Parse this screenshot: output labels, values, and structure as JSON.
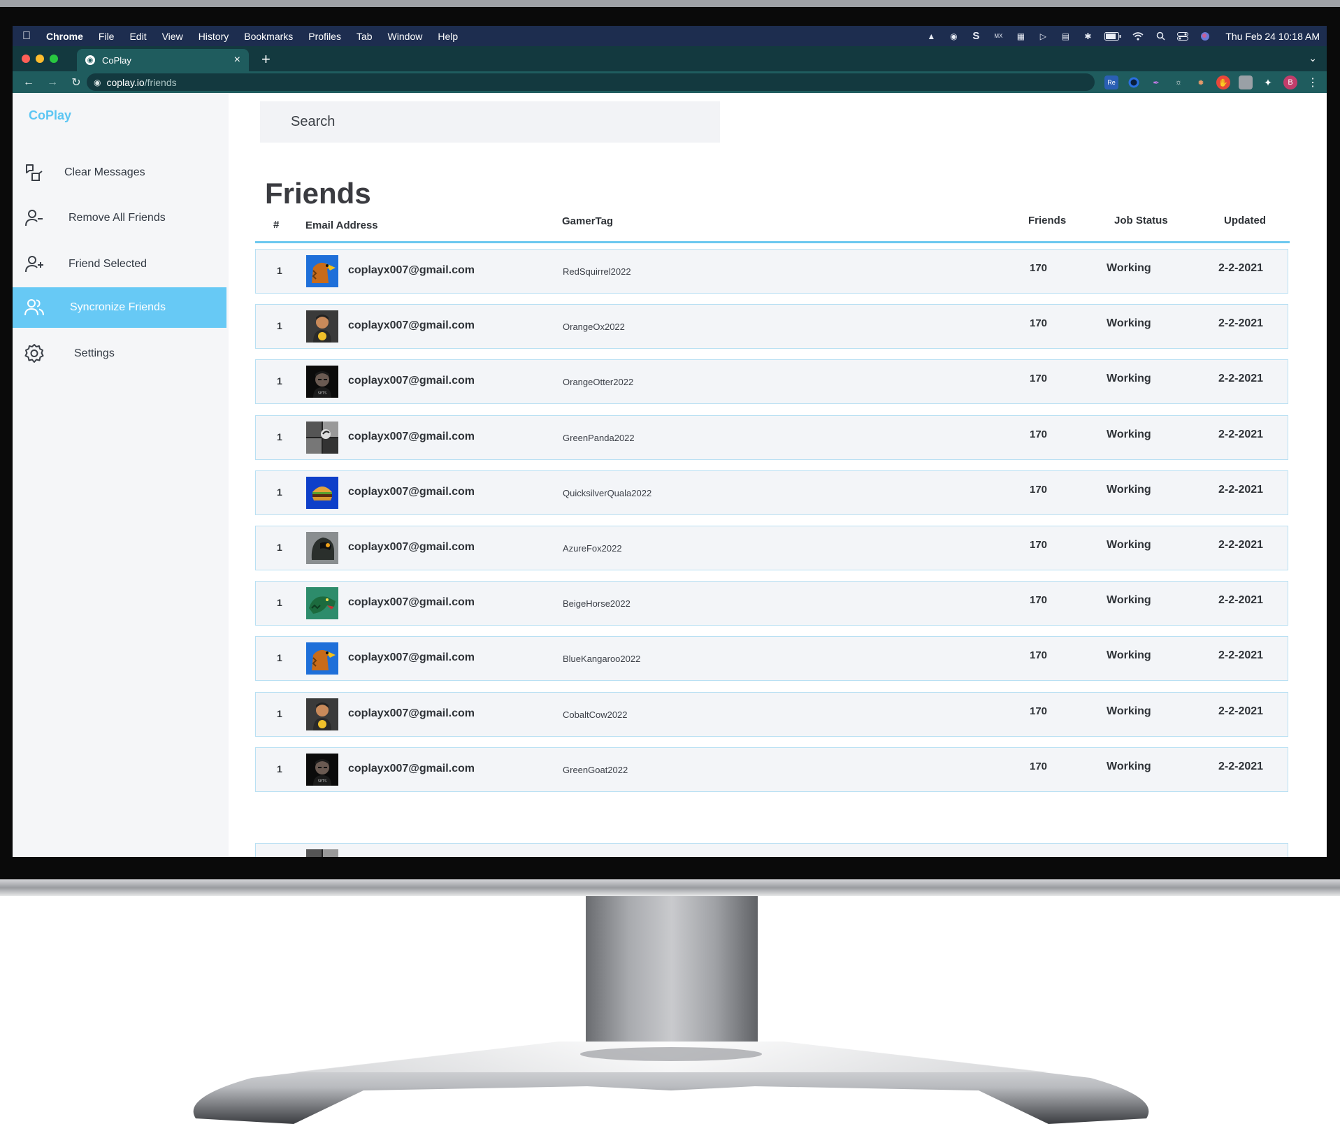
{
  "mac_menubar": {
    "app_name": "Chrome",
    "menus": [
      "File",
      "Edit",
      "View",
      "History",
      "Bookmarks",
      "Profiles",
      "Tab",
      "Window",
      "Help"
    ],
    "clock": "Thu Feb 24  10:18 AM",
    "status_icons": [
      "drive-icon",
      "globe-icon",
      "s-icon",
      "mx-icon",
      "grid-icon",
      "play-icon",
      "card-icon",
      "bluetooth-icon",
      "battery-icon",
      "wifi-icon",
      "spotlight-icon",
      "control-center-icon",
      "siri-icon"
    ]
  },
  "browser": {
    "tab_title": "CoPlay",
    "new_tab_label": "+",
    "url_host": "coplay.io",
    "url_path": "/friends",
    "profile_initial": "B",
    "colors": {
      "menubar": "#1d2d4f",
      "tabbar": "#13393f",
      "toolbar": "#1f5c5e"
    }
  },
  "app": {
    "brand": "CoPlay",
    "sidebar": [
      {
        "label": "Clear Messages",
        "icon": "clear-messages-icon",
        "active": false
      },
      {
        "label": "Remove All Friends",
        "icon": "user-minus-icon",
        "active": false
      },
      {
        "label": "Friend Selected",
        "icon": "user-plus-icon",
        "active": false
      },
      {
        "label": "Syncronize Friends",
        "icon": "users-icon",
        "active": true
      },
      {
        "label": "Settings",
        "icon": "gear-icon",
        "active": false
      }
    ],
    "search_placeholder": "Search",
    "page_title": "Friends",
    "accent_color": "#67c9f5",
    "table": {
      "headers": {
        "num": "#",
        "email": "Email Address",
        "gamertag": "GamerTag",
        "friends": "Friends",
        "status": "Job Status",
        "updated": "Updated"
      },
      "rows": [
        {
          "num": "1",
          "avatar": "eagle-avatar",
          "email": "coplayx007@gmail.com",
          "gamertag": "RedSquirrel2022",
          "friends": "170",
          "status": "Working",
          "updated": "2-2-2021"
        },
        {
          "num": "1",
          "avatar": "gamer-avatar",
          "email": "coplayx007@gmail.com",
          "gamertag": "OrangeOx2022",
          "friends": "170",
          "status": "Working",
          "updated": "2-2-2021"
        },
        {
          "num": "1",
          "avatar": "dark-face-avatar",
          "email": "coplayx007@gmail.com",
          "gamertag": "OrangeOtter2022",
          "friends": "170",
          "status": "Working",
          "updated": "2-2-2021"
        },
        {
          "num": "1",
          "avatar": "collage-avatar",
          "email": "coplayx007@gmail.com",
          "gamertag": "GreenPanda2022",
          "friends": "170",
          "status": "Working",
          "updated": "2-2-2021"
        },
        {
          "num": "1",
          "avatar": "burger-avatar",
          "email": "coplayx007@gmail.com",
          "gamertag": "QuicksilverQuala2022",
          "friends": "170",
          "status": "Working",
          "updated": "2-2-2021"
        },
        {
          "num": "1",
          "avatar": "helmet-avatar",
          "email": "coplayx007@gmail.com",
          "gamertag": "AzureFox2022",
          "friends": "170",
          "status": "Working",
          "updated": "2-2-2021"
        },
        {
          "num": "1",
          "avatar": "dino-avatar",
          "email": "coplayx007@gmail.com",
          "gamertag": "BeigeHorse2022",
          "friends": "170",
          "status": "Working",
          "updated": "2-2-2021"
        },
        {
          "num": "1",
          "avatar": "eagle-avatar",
          "email": "coplayx007@gmail.com",
          "gamertag": "BlueKangaroo2022",
          "friends": "170",
          "status": "Working",
          "updated": "2-2-2021"
        },
        {
          "num": "1",
          "avatar": "gamer-avatar",
          "email": "coplayx007@gmail.com",
          "gamertag": "CobaltCow2022",
          "friends": "170",
          "status": "Working",
          "updated": "2-2-2021"
        },
        {
          "num": "1",
          "avatar": "dark-face-avatar",
          "email": "coplayx007@gmail.com",
          "gamertag": "GreenGoat2022",
          "friends": "170",
          "status": "Working",
          "updated": "2-2-2021"
        }
      ]
    }
  }
}
